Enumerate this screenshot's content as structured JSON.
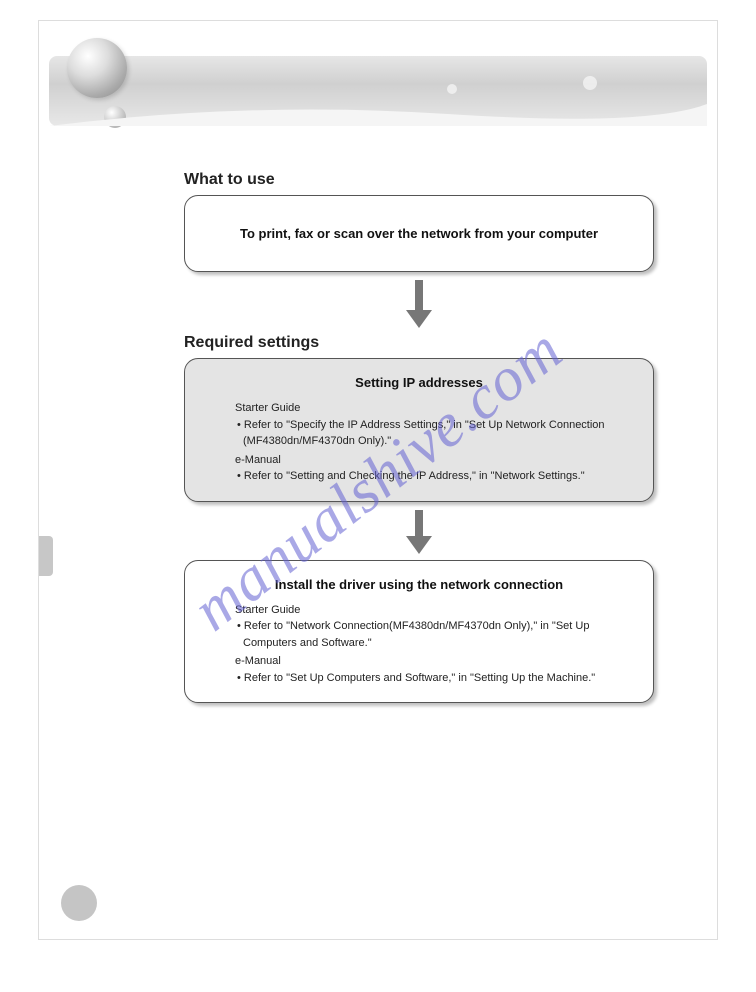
{
  "watermark": "manualshive.com",
  "section1": {
    "title": "What to use",
    "box_heading": "To print, fax or scan over the network from your computer"
  },
  "section2": {
    "title": "Required settings",
    "box1": {
      "heading": "Setting IP addresses",
      "starter_label": "Starter Guide",
      "starter_item": "• Refer to \"Specify the IP Address Settings,\" in \"Set Up Network Connection (MF4380dn/MF4370dn Only).\"",
      "emanual_label": "e-Manual",
      "emanual_item": "• Refer to \"Setting and Checking the IP Address,\" in \"Network Settings.\""
    },
    "box2": {
      "heading": "Install the driver using the network connection",
      "starter_label": "Starter Guide",
      "starter_item": "• Refer to \"Network Connection(MF4380dn/MF4370dn Only),\" in \"Set Up Computers and Software.\"",
      "emanual_label": "e-Manual",
      "emanual_item": "• Refer to \"Set Up Computers and Software,\" in \"Setting Up the Machine.\""
    }
  }
}
